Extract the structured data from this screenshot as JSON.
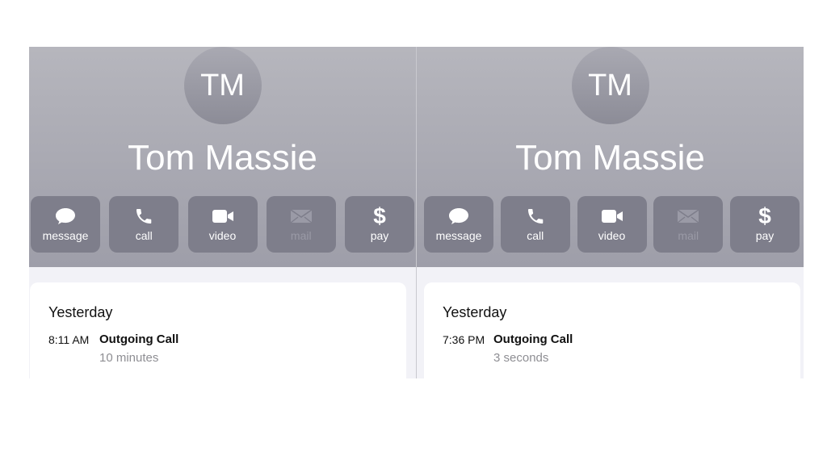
{
  "screens": [
    {
      "contact": {
        "initials": "TM",
        "name": "Tom Massie"
      },
      "actions": [
        {
          "label": "message",
          "icon": "message-bubble-icon",
          "enabled": true
        },
        {
          "label": "call",
          "icon": "phone-icon",
          "enabled": true
        },
        {
          "label": "video",
          "icon": "video-camera-icon",
          "enabled": true
        },
        {
          "label": "mail",
          "icon": "envelope-icon",
          "enabled": false
        },
        {
          "label": "pay",
          "icon": "dollar-icon",
          "enabled": true
        }
      ],
      "history": {
        "day": "Yesterday",
        "time": "8:11 AM",
        "type": "Outgoing Call",
        "duration": "10 minutes"
      }
    },
    {
      "contact": {
        "initials": "TM",
        "name": "Tom Massie"
      },
      "actions": [
        {
          "label": "message",
          "icon": "message-bubble-icon",
          "enabled": true
        },
        {
          "label": "call",
          "icon": "phone-icon",
          "enabled": true
        },
        {
          "label": "video",
          "icon": "video-camera-icon",
          "enabled": true
        },
        {
          "label": "mail",
          "icon": "envelope-icon",
          "enabled": false
        },
        {
          "label": "pay",
          "icon": "dollar-icon",
          "enabled": true
        }
      ],
      "history": {
        "day": "Yesterday",
        "time": "7:36 PM",
        "type": "Outgoing Call",
        "duration": "3 seconds"
      }
    }
  ],
  "colors": {
    "header_top": "#b6b6bd",
    "header_bottom": "#9e9ea9",
    "action_button": "#7e7e8b",
    "card": "#ffffff",
    "secondary_text": "#8e8e93"
  }
}
